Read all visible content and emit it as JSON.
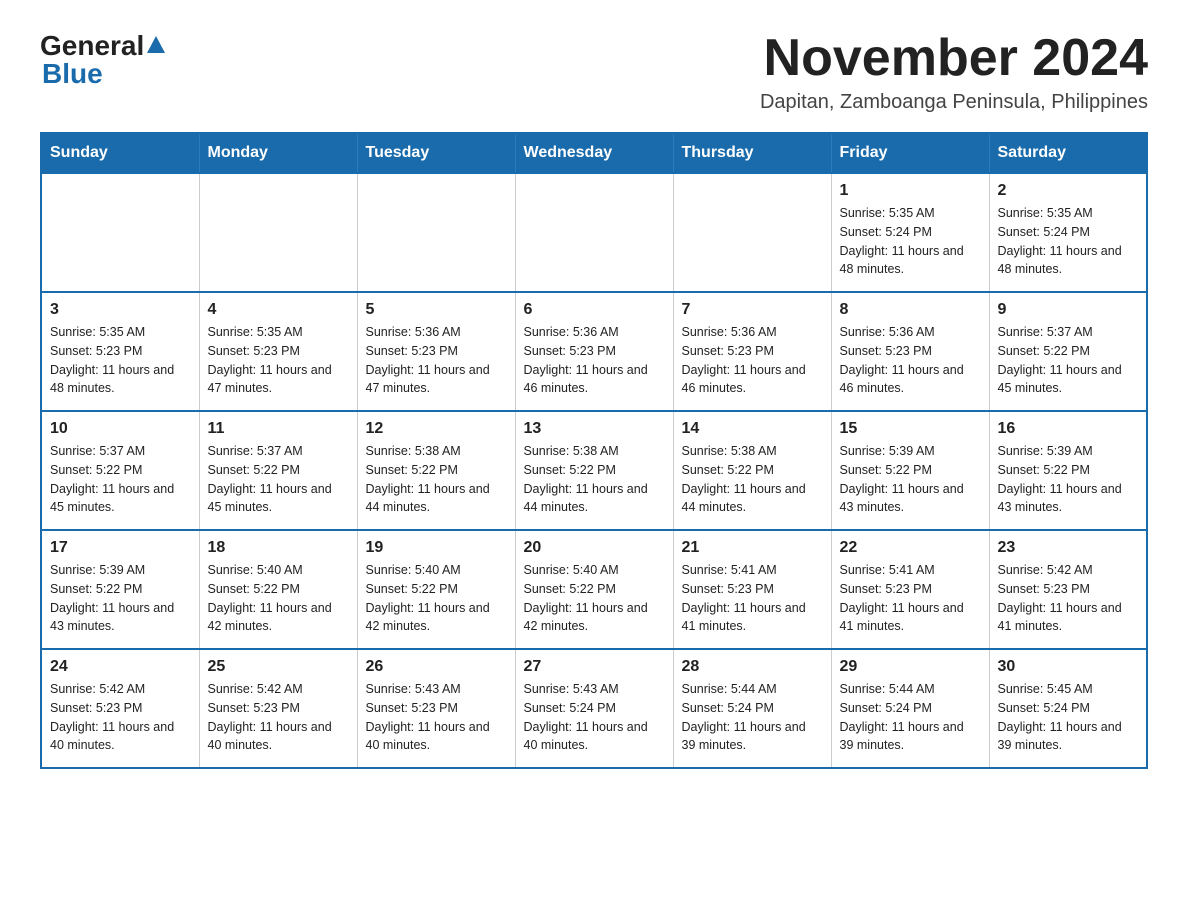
{
  "logo": {
    "name_part1": "General",
    "name_part2": "Blue"
  },
  "title": {
    "month_year": "November 2024",
    "location": "Dapitan, Zamboanga Peninsula, Philippines"
  },
  "days_header": [
    "Sunday",
    "Monday",
    "Tuesday",
    "Wednesday",
    "Thursday",
    "Friday",
    "Saturday"
  ],
  "weeks": [
    [
      {
        "day": "",
        "info": ""
      },
      {
        "day": "",
        "info": ""
      },
      {
        "day": "",
        "info": ""
      },
      {
        "day": "",
        "info": ""
      },
      {
        "day": "",
        "info": ""
      },
      {
        "day": "1",
        "info": "Sunrise: 5:35 AM\nSunset: 5:24 PM\nDaylight: 11 hours and 48 minutes."
      },
      {
        "day": "2",
        "info": "Sunrise: 5:35 AM\nSunset: 5:24 PM\nDaylight: 11 hours and 48 minutes."
      }
    ],
    [
      {
        "day": "3",
        "info": "Sunrise: 5:35 AM\nSunset: 5:23 PM\nDaylight: 11 hours and 48 minutes."
      },
      {
        "day": "4",
        "info": "Sunrise: 5:35 AM\nSunset: 5:23 PM\nDaylight: 11 hours and 47 minutes."
      },
      {
        "day": "5",
        "info": "Sunrise: 5:36 AM\nSunset: 5:23 PM\nDaylight: 11 hours and 47 minutes."
      },
      {
        "day": "6",
        "info": "Sunrise: 5:36 AM\nSunset: 5:23 PM\nDaylight: 11 hours and 46 minutes."
      },
      {
        "day": "7",
        "info": "Sunrise: 5:36 AM\nSunset: 5:23 PM\nDaylight: 11 hours and 46 minutes."
      },
      {
        "day": "8",
        "info": "Sunrise: 5:36 AM\nSunset: 5:23 PM\nDaylight: 11 hours and 46 minutes."
      },
      {
        "day": "9",
        "info": "Sunrise: 5:37 AM\nSunset: 5:22 PM\nDaylight: 11 hours and 45 minutes."
      }
    ],
    [
      {
        "day": "10",
        "info": "Sunrise: 5:37 AM\nSunset: 5:22 PM\nDaylight: 11 hours and 45 minutes."
      },
      {
        "day": "11",
        "info": "Sunrise: 5:37 AM\nSunset: 5:22 PM\nDaylight: 11 hours and 45 minutes."
      },
      {
        "day": "12",
        "info": "Sunrise: 5:38 AM\nSunset: 5:22 PM\nDaylight: 11 hours and 44 minutes."
      },
      {
        "day": "13",
        "info": "Sunrise: 5:38 AM\nSunset: 5:22 PM\nDaylight: 11 hours and 44 minutes."
      },
      {
        "day": "14",
        "info": "Sunrise: 5:38 AM\nSunset: 5:22 PM\nDaylight: 11 hours and 44 minutes."
      },
      {
        "day": "15",
        "info": "Sunrise: 5:39 AM\nSunset: 5:22 PM\nDaylight: 11 hours and 43 minutes."
      },
      {
        "day": "16",
        "info": "Sunrise: 5:39 AM\nSunset: 5:22 PM\nDaylight: 11 hours and 43 minutes."
      }
    ],
    [
      {
        "day": "17",
        "info": "Sunrise: 5:39 AM\nSunset: 5:22 PM\nDaylight: 11 hours and 43 minutes."
      },
      {
        "day": "18",
        "info": "Sunrise: 5:40 AM\nSunset: 5:22 PM\nDaylight: 11 hours and 42 minutes."
      },
      {
        "day": "19",
        "info": "Sunrise: 5:40 AM\nSunset: 5:22 PM\nDaylight: 11 hours and 42 minutes."
      },
      {
        "day": "20",
        "info": "Sunrise: 5:40 AM\nSunset: 5:22 PM\nDaylight: 11 hours and 42 minutes."
      },
      {
        "day": "21",
        "info": "Sunrise: 5:41 AM\nSunset: 5:23 PM\nDaylight: 11 hours and 41 minutes."
      },
      {
        "day": "22",
        "info": "Sunrise: 5:41 AM\nSunset: 5:23 PM\nDaylight: 11 hours and 41 minutes."
      },
      {
        "day": "23",
        "info": "Sunrise: 5:42 AM\nSunset: 5:23 PM\nDaylight: 11 hours and 41 minutes."
      }
    ],
    [
      {
        "day": "24",
        "info": "Sunrise: 5:42 AM\nSunset: 5:23 PM\nDaylight: 11 hours and 40 minutes."
      },
      {
        "day": "25",
        "info": "Sunrise: 5:42 AM\nSunset: 5:23 PM\nDaylight: 11 hours and 40 minutes."
      },
      {
        "day": "26",
        "info": "Sunrise: 5:43 AM\nSunset: 5:23 PM\nDaylight: 11 hours and 40 minutes."
      },
      {
        "day": "27",
        "info": "Sunrise: 5:43 AM\nSunset: 5:24 PM\nDaylight: 11 hours and 40 minutes."
      },
      {
        "day": "28",
        "info": "Sunrise: 5:44 AM\nSunset: 5:24 PM\nDaylight: 11 hours and 39 minutes."
      },
      {
        "day": "29",
        "info": "Sunrise: 5:44 AM\nSunset: 5:24 PM\nDaylight: 11 hours and 39 minutes."
      },
      {
        "day": "30",
        "info": "Sunrise: 5:45 AM\nSunset: 5:24 PM\nDaylight: 11 hours and 39 minutes."
      }
    ]
  ],
  "colors": {
    "header_bg": "#1a6bab",
    "header_text": "#ffffff",
    "border": "#1a6bab"
  }
}
